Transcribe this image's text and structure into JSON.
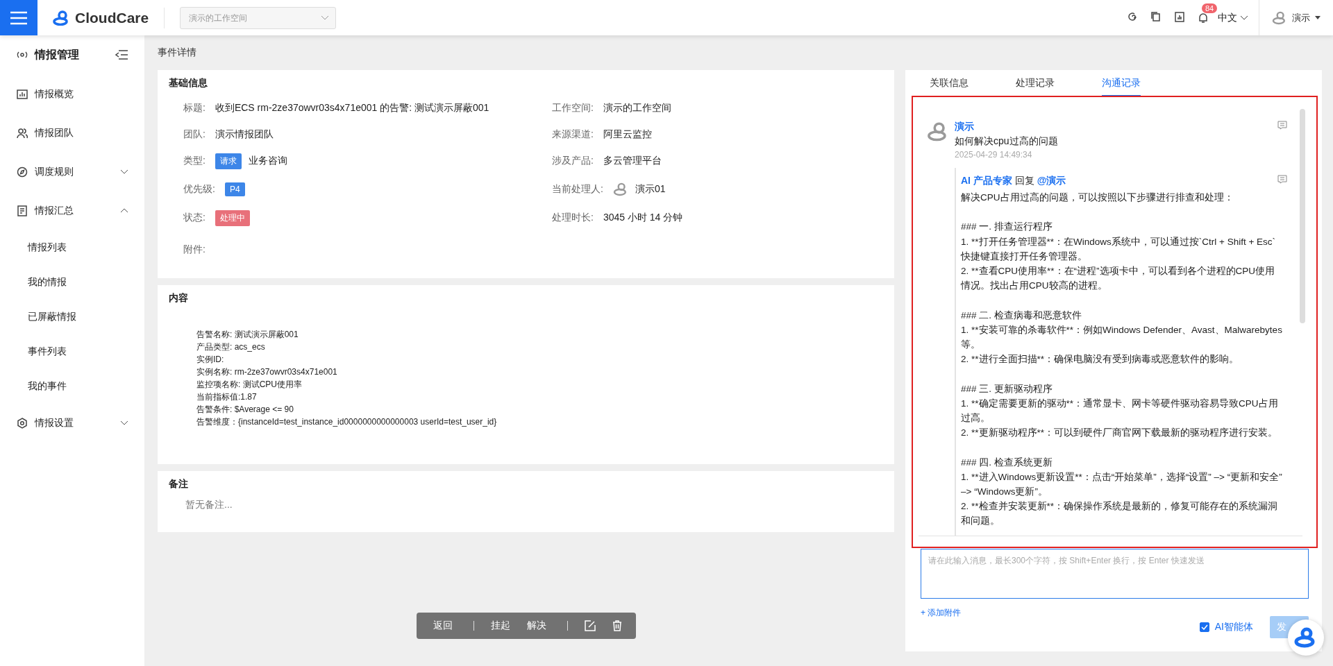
{
  "topbar": {
    "brand": "CloudCare",
    "workspace_select": {
      "placeholder": "演示的工作空间"
    },
    "notification_count": "84",
    "language": "中文",
    "user": "演示"
  },
  "sidebar": {
    "title": "情报管理",
    "items": [
      {
        "label": "情报概览"
      },
      {
        "label": "情报团队"
      },
      {
        "label": "调度规则",
        "expanded": false
      },
      {
        "label": "情报汇总",
        "expanded": true,
        "children": [
          {
            "label": "情报列表"
          },
          {
            "label": "我的情报"
          },
          {
            "label": "已屏蔽情报"
          },
          {
            "label": "事件列表"
          },
          {
            "label": "我的事件"
          }
        ]
      },
      {
        "label": "情报设置",
        "expanded": false
      }
    ]
  },
  "breadcrumb": "事件详情",
  "basic_info": {
    "title": "基础信息",
    "left": [
      {
        "label": "标题:",
        "kind": "text",
        "value": "收到ECS rm-2ze37owvr03s4x71e001 的告警: 测试演示屏蔽001"
      },
      {
        "label": "团队:",
        "kind": "text",
        "value": "演示情报团队"
      },
      {
        "label": "类型:",
        "kind": "tag",
        "tag": "请求",
        "color": "#3d86e8",
        "value": "业务咨询"
      },
      {
        "label": "优先级:",
        "kind": "tag",
        "tag": "P4",
        "color": "#3d86e8"
      },
      {
        "label": "状态:",
        "kind": "tag",
        "tag": "处理中",
        "color": "#e8707a"
      },
      {
        "label": "附件:",
        "kind": "text"
      }
    ],
    "right": [
      {
        "label": "工作空间:",
        "kind": "text",
        "value": "演示的工作空间"
      },
      {
        "label": "来源渠道:",
        "kind": "text",
        "value": "阿里云监控"
      },
      {
        "label": "涉及产品:",
        "kind": "text",
        "value": "多云管理平台"
      },
      {
        "label": "当前处理人:",
        "kind": "avatar",
        "value": "演示01"
      },
      {
        "label": "处理时长:",
        "kind": "text",
        "value": "3045 小时 14 分钟"
      }
    ]
  },
  "content": {
    "title": "内容",
    "lines": [
      "告警名称: 测试演示屏蔽001",
      "产品类型: acs_ecs",
      "实例ID:",
      "实例名称: rm-2ze37owvr03s4x71e001",
      "监控项名称: 测试CPU使用率",
      "当前指标值:1.87",
      "告警条件: $Average <= 90",
      "告警维度：{instanceId=test_instance_id0000000000000003 userId=test_user_id}"
    ]
  },
  "notes": {
    "title": "备注",
    "empty_text": "暂无备注..."
  },
  "toolbar": {
    "groups": [
      [
        "返回"
      ],
      [
        "挂起",
        "解决"
      ]
    ]
  },
  "tabs": [
    {
      "label": "关联信息",
      "selected": false
    },
    {
      "label": "处理记录",
      "selected": false
    },
    {
      "label": "沟通记录",
      "selected": true
    }
  ],
  "messages": [
    {
      "author": "演示",
      "text": "如何解决cpu过高的问题",
      "time": "2025-04-29 14:49:34",
      "replies": [
        {
          "author": "AI 产品专家",
          "verb": "回复",
          "mention": "@演示",
          "body": "解决CPU占用过高的问题，可以按照以下步骤进行排查和处理：\n\n### 一. 排查运行程序\n1. **打开任务管理器**：在Windows系统中，可以通过按`Ctrl + Shift + Esc`快捷键直接打开任务管理器。\n2. **查看CPU使用率**：在“进程”选项卡中，可以看到各个进程的CPU使用情况。找出占用CPU较高的进程。\n\n### 二. 检查病毒和恶意软件\n1. **安装可靠的杀毒软件**：例如Windows Defender、Avast、Malwarebytes等。\n2. **进行全面扫描**：确保电脑没有受到病毒或恶意软件的影响。\n\n### 三. 更新驱动程序\n1. **确定需要更新的驱动**：通常显卡、网卡等硬件驱动容易导致CPU占用过高。\n2. **更新驱动程序**：可以到硬件厂商官网下载最新的驱动程序进行安装。\n\n### 四. 检查系统更新\n1. **进入Windows更新设置**：点击“开始菜单”，选择“设置” –> “更新和安全” –> “Windows更新”。\n2. **检查并安装更新**：确保操作系统是最新的，修复可能存在的系统漏洞和问题。"
        }
      ]
    }
  ],
  "composer": {
    "placeholder": "请在此输入消息，最长300个字符，按 Shift+Enter 换行，按 Enter 快速发送",
    "attach": "+ 添加附件",
    "agent": {
      "label": "AI智能体",
      "checked": true
    },
    "send": {
      "label": "发",
      "disabled": true
    }
  }
}
